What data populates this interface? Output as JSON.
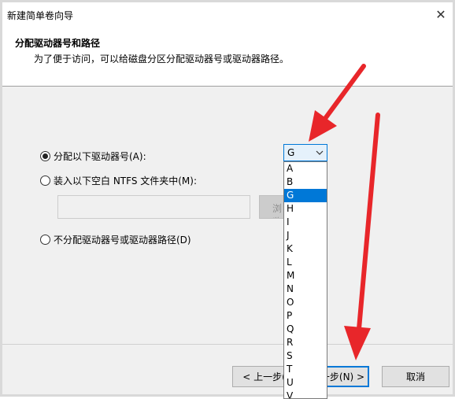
{
  "window": {
    "title": "新建简单卷向导",
    "close_glyph": "✕"
  },
  "header": {
    "title": "分配驱动器号和路径",
    "subtitle": "为了便于访问，可以给磁盘分区分配驱动器号或驱动器路径。"
  },
  "options": {
    "assign_letter": "分配以下驱动器号(A):",
    "mount_folder": "装入以下空白 NTFS 文件夹中(M):",
    "no_assign": "不分配驱动器号或驱动器路径(D)",
    "browse_label": "浏览"
  },
  "drive_combo": {
    "value": "G",
    "options": [
      "A",
      "B",
      "G",
      "H",
      "I",
      "J",
      "K",
      "L",
      "M",
      "N",
      "O",
      "P",
      "Q",
      "R",
      "S",
      "T",
      "U",
      "V"
    ]
  },
  "buttons": {
    "back": "< 上一步(B)",
    "next": "下一步(N) >",
    "cancel": "取消"
  },
  "colors": {
    "accent": "#0078d7",
    "arrow": "#e8262a"
  }
}
